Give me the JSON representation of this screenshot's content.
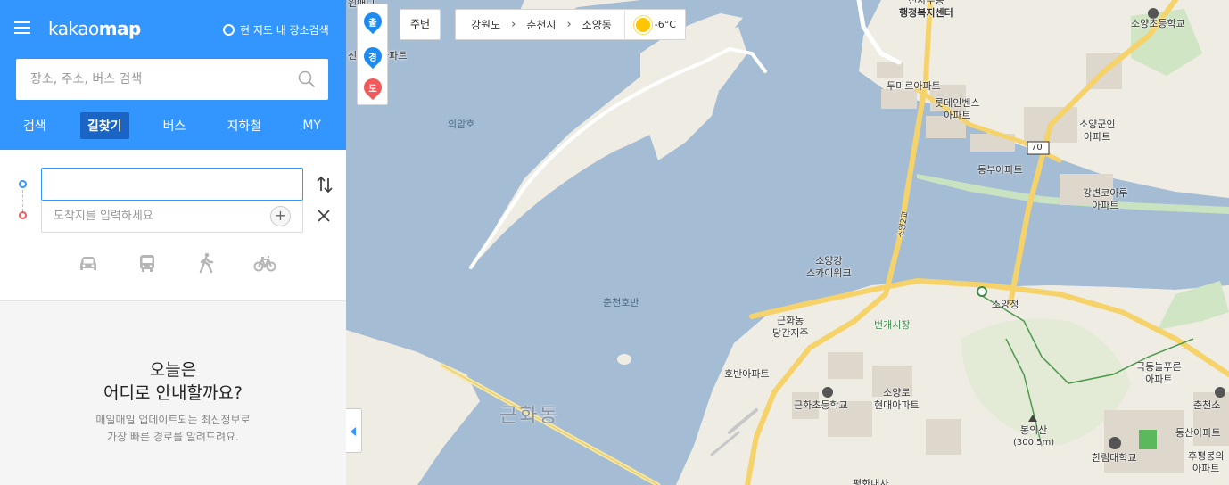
{
  "app": {
    "logo_light": "kakao",
    "logo_bold": "map",
    "area_search": "현 지도 내 장소검색"
  },
  "search": {
    "placeholder": "장소, 주소, 버스 검색"
  },
  "tabs": [
    "검색",
    "길찾기",
    "버스",
    "지하철",
    "MY"
  ],
  "route": {
    "start_value": "",
    "end_placeholder": "도착지를 입력하세요",
    "modes": [
      "car-icon",
      "bus-icon",
      "walk-icon",
      "bike-icon"
    ]
  },
  "promo": {
    "title_line1": "오늘은",
    "title_line2": "어디로 안내할까요?",
    "desc_line1": "매일매일 업데이트되는 최신정보로",
    "desc_line2": "가장 빠른 경로를 알려드려요."
  },
  "map": {
    "pins": [
      "출",
      "경",
      "도"
    ],
    "nearby": "주변",
    "location": [
      "강원도",
      "춘천시",
      "소양동"
    ],
    "weather_temp": "-6°C",
    "labels": {
      "top_left_a": "원애니",
      "top_left_b": "신",
      "top_left_c": "아파트",
      "lake1": "의암호",
      "lake2": "춘천호반",
      "welfare_a": "신사우동",
      "welfare_b": "행정복지센터",
      "school1": "소양초등학교",
      "apt_dumiru": "두미르아파트",
      "apt_lotte_a": "롯데인벤스",
      "apt_lotte_b": "아파트",
      "apt_soyang_mil_a": "소양군인",
      "apt_soyang_mil_b": "아파트",
      "route_no": "70",
      "apt_dongbu": "동부아파트",
      "apt_gangbyeon_a": "강변코아루",
      "apt_gangbyeon_b": "아파트",
      "road_name": "소양2교",
      "skywalk_a": "소양강",
      "skywalk_b": "스카이워크",
      "soyangjeong": "소양정",
      "geunhwa_a": "근화동",
      "geunhwa_b": "당간지주",
      "market": "번개시장",
      "apt_hoban": "호반아파트",
      "apt_geukdong_a": "극동늘푸른",
      "apt_geukdong_b": "아파트",
      "school2": "근화초등학교",
      "apt_hyundai_a": "소양로",
      "apt_hyundai_b": "현대아파트",
      "mountain_a": "봉의산",
      "mountain_b": "(300.5m)",
      "apt_dongsan": "동산아파트",
      "college": "한림대학교",
      "apt_hupyeong_a": "후평봉의",
      "apt_hupyeong_b": "아파트",
      "chuncheon": "춘천소",
      "district": "근화동",
      "bottom_cut": "평화내사"
    }
  }
}
